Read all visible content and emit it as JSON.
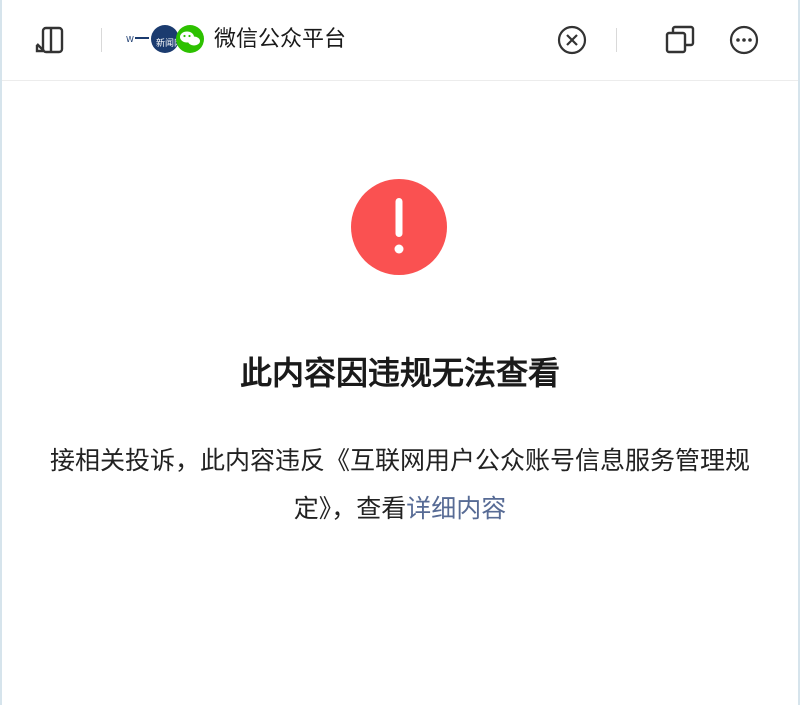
{
  "topbar": {
    "app_title": "微信公众平台",
    "logo_text": "新闻网",
    "logo_brand_text": "W 新闻网",
    "icons": {
      "split": "sidebar-toggle-icon",
      "close": "close-circle-icon",
      "copy": "copy-window-icon",
      "more": "more-options-icon"
    }
  },
  "main": {
    "headline": "此内容因违规无法查看",
    "description_part1": "接相关投诉，此内容违反《互联网用户公众账号信息服务管理规定》，查看",
    "details_link": "详细内容",
    "warning_icon_color": "#fa5151",
    "link_color": "#576b95"
  }
}
